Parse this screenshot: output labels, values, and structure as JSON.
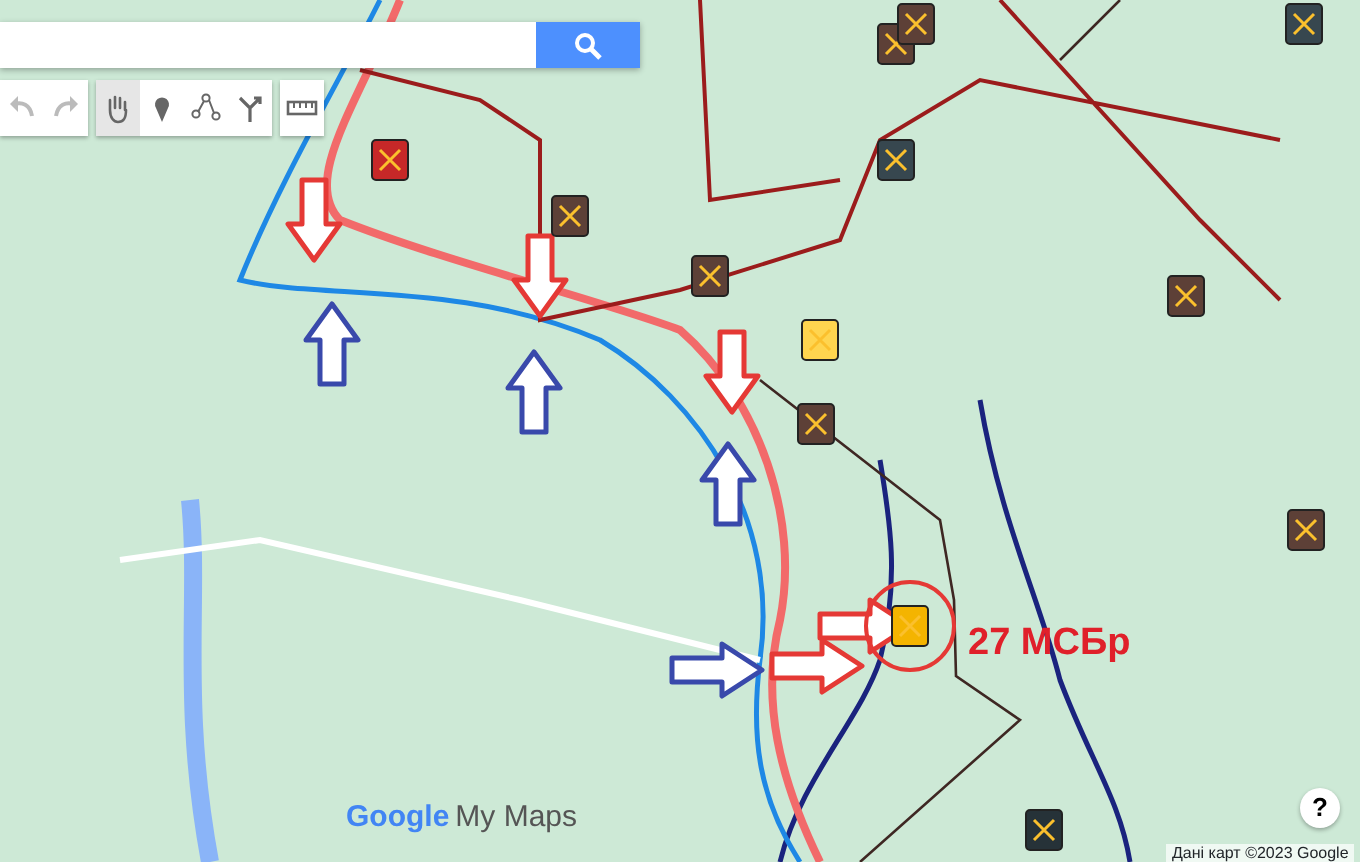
{
  "toolbar": [
    {
      "kind": "undo",
      "selected": false
    },
    {
      "kind": "redo",
      "selected": false
    },
    {
      "kind": "hand",
      "selected": true
    },
    {
      "kind": "pin",
      "selected": false
    },
    {
      "kind": "line",
      "selected": false
    },
    {
      "kind": "route",
      "selected": false
    },
    {
      "kind": "ruler",
      "selected": false
    }
  ],
  "annotation": {
    "label": "27 МСБр"
  },
  "logo": {
    "brand": "Google",
    "product": "My Maps"
  },
  "help": "?",
  "attribution": "Дані карт ©2023 Google"
}
